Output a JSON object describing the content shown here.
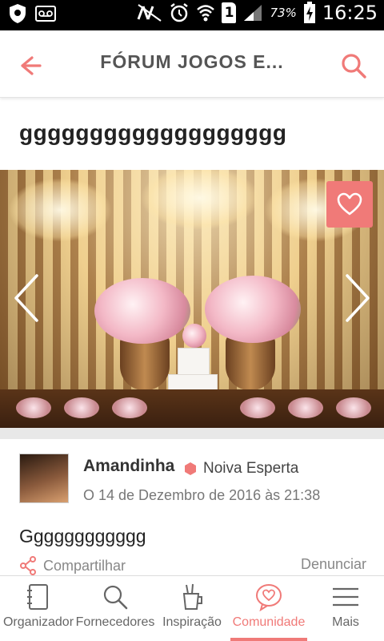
{
  "status_bar": {
    "battery_pct": "73%",
    "sim_slot": "1",
    "time": "16:25"
  },
  "app_bar": {
    "title": "FÓRUM JOGOS E..."
  },
  "post": {
    "title": "ggggggggggggggggggg",
    "body": "Gggggggggggg"
  },
  "author": {
    "name": "Amandinha",
    "badge": "Noiva Esperta",
    "date": "O 14 de Dezembro de 2016 às 21:38"
  },
  "actions": {
    "share": "Compartilhar",
    "report": "Denunciar"
  },
  "bottom_nav": [
    {
      "label": "Organizador",
      "icon": "notebook-icon"
    },
    {
      "label": "Fornecedores",
      "icon": "search-icon"
    },
    {
      "label": "Inspiração",
      "icon": "paint-bucket-icon"
    },
    {
      "label": "Comunidade",
      "icon": "heart-bubble-icon",
      "active": true
    },
    {
      "label": "Mais",
      "icon": "menu-icon"
    }
  ],
  "colors": {
    "accent": "#f07a78",
    "text": "#222222",
    "muted": "#888888"
  }
}
